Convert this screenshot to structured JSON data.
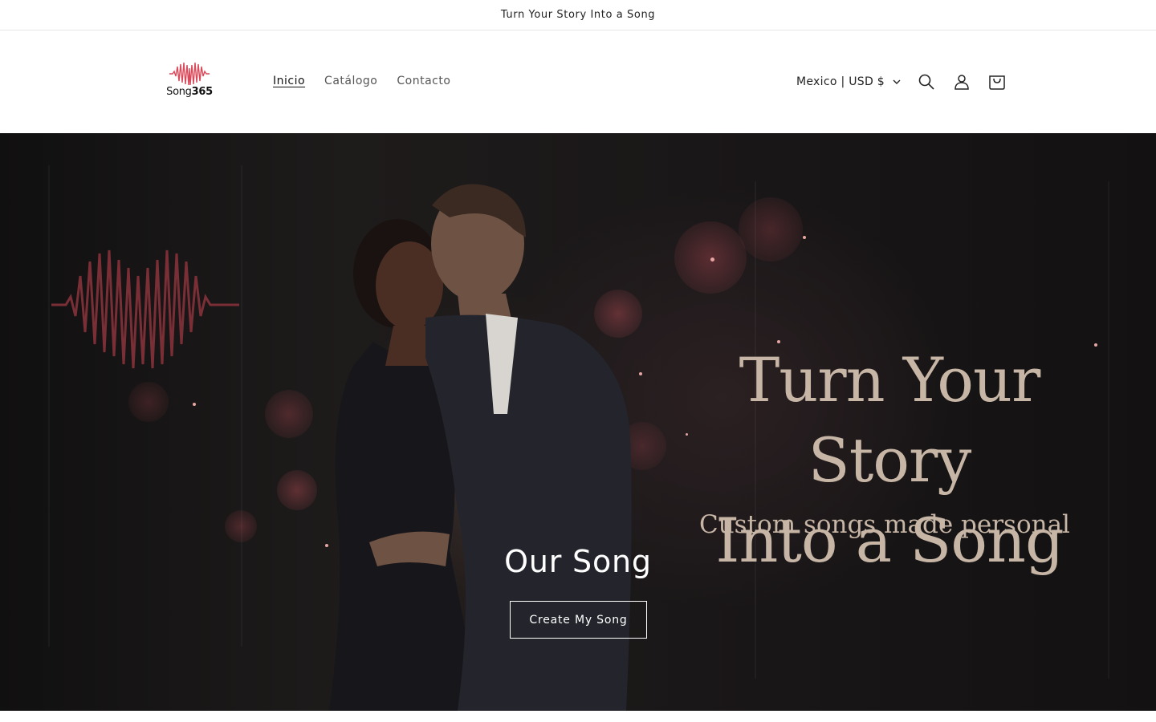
{
  "announcement": {
    "text": "Turn Your Story Into a Song"
  },
  "logo": {
    "brand_light": "Song",
    "brand_bold": "365",
    "mark_color": "#d94a5a"
  },
  "nav": {
    "items": [
      {
        "label": "Inicio",
        "active": true
      },
      {
        "label": "Catálogo",
        "active": false
      },
      {
        "label": "Contacto",
        "active": false
      }
    ]
  },
  "header": {
    "country_selector": "Mexico | USD $",
    "icons": [
      "search-icon",
      "account-icon",
      "cart-icon"
    ]
  },
  "hero": {
    "image_headline_line1": "Turn Your Story",
    "image_headline_line2": "Into a Song",
    "image_subline": "Custom songs made personal",
    "title": "Our Song",
    "button_label": "Create My Song",
    "headline_color": "#c7b6a6",
    "accent_color": "#e07a7a"
  }
}
